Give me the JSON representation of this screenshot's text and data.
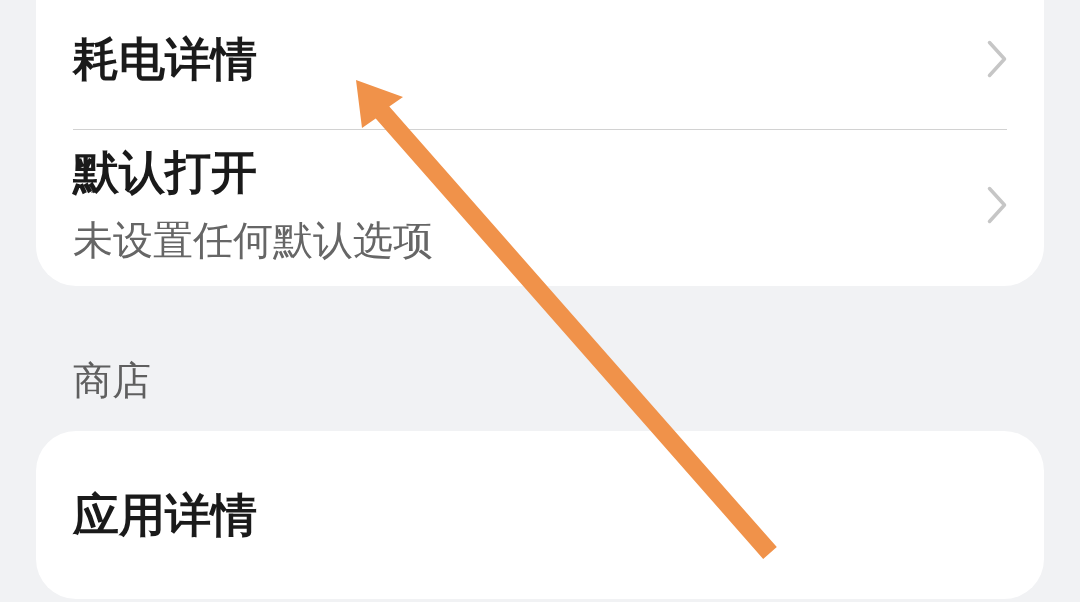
{
  "groups": [
    {
      "items": [
        {
          "title": "耗电详情",
          "chevron": true
        },
        {
          "title": "默认打开",
          "subtitle": "未设置任何默认选项",
          "chevron": true
        }
      ]
    },
    {
      "header": "商店",
      "items": [
        {
          "title": "应用详情",
          "chevron": false
        }
      ]
    }
  ],
  "annotation": {
    "kind": "arrow"
  }
}
